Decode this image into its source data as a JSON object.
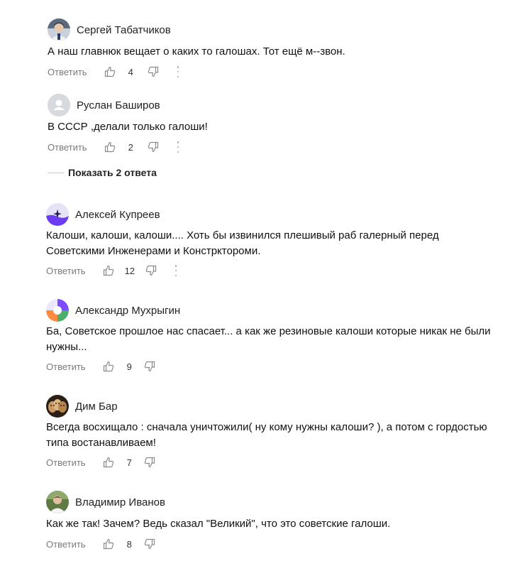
{
  "reply_label": "Ответить",
  "show_replies_label": "Показать 2 ответа",
  "comments": [
    {
      "author": "Сергей Табатчиков",
      "text": "А наш главнюк вещает о каких то галошах. Тот ещё м--звон.",
      "likes": "4",
      "avatar": "photo-man-avatar"
    },
    {
      "author": "Руслан Баширов",
      "text": "В СССР ,делали только галоши!",
      "likes": "2",
      "avatar": "default-user-avatar"
    },
    {
      "author": "Алексей Купреев",
      "text": "Калоши, калоши, калоши.... Хоть бы извинился плешивый раб галерный перед Советскими Инженерами и Констрктороми.",
      "likes": "12",
      "avatar": "purple-sparkle-avatar"
    },
    {
      "author": "Александр Мухрыгин",
      "text": "Ба, Советское прошлое нас спасает... а как же резиновые калоши которые никак не были нужны...",
      "likes": "9",
      "avatar": "tricolor-avatar"
    },
    {
      "author": "Дим Бар",
      "text": "Всегда восхищало : сначала уничтожили( ну кому нужны калоши? ), а потом с гордостью типа востанавливаем!",
      "likes": "7",
      "avatar": "masks-photo-avatar"
    },
    {
      "author": "Владимир Иванов",
      "text": "Как же так! Зачем? Ведь сказал \"Великий\", что это советские галоши.",
      "likes": "8",
      "avatar": "photo-man-outdoor-avatar"
    }
  ]
}
